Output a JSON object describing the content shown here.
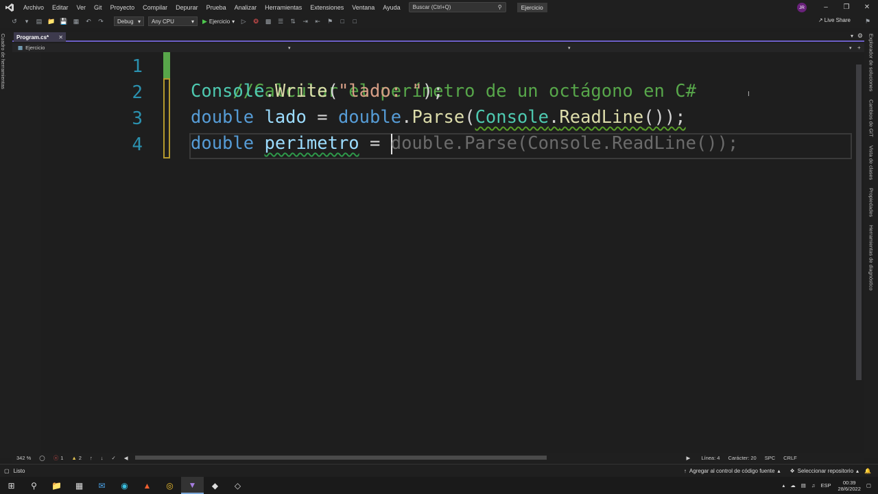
{
  "menu": {
    "items": [
      "Archivo",
      "Editar",
      "Ver",
      "Git",
      "Proyecto",
      "Compilar",
      "Depurar",
      "Prueba",
      "Analizar",
      "Herramientas",
      "Extensiones",
      "Ventana",
      "Ayuda"
    ],
    "search_placeholder": "Buscar (Ctrl+Q)",
    "solution_name": "Ejercicio",
    "user_initials": "JR"
  },
  "toolbar": {
    "config": "Debug",
    "platform": "Any CPU",
    "run_target": "Ejercicio",
    "live_share": "Live Share"
  },
  "left_rail": {
    "label": "Cuadro de herramientas"
  },
  "right_rail": {
    "labels": [
      "Explorador de soluciones",
      "Cambios de GIT",
      "Vista de clases",
      "Propiedades",
      "Herramientas de diagnóstico"
    ]
  },
  "editor": {
    "tab_label": "Program.cs*",
    "tab_close": "✕",
    "nav_project": "Ejercicio",
    "line_numbers": [
      "1",
      "2",
      "3",
      "4"
    ],
    "lines": {
      "l1": "//Calcular el perímetro de un octágono en C#",
      "l2_type": "Console",
      "l2_dot": ".",
      "l2_method": "Write",
      "l2_open": "(",
      "l2_str": "\"lado: \"",
      "l2_close": ");",
      "l3_kw": "double",
      "l3_var": " lado",
      "l3_eq": " = ",
      "l3_kw2": "double",
      "l3_dot": ".",
      "l3_method": "Parse",
      "l3_open": "(",
      "l3_type": "Console",
      "l3_dot2": ".",
      "l3_method2": "ReadLine",
      "l3_close": "());",
      "l4_kw": "double",
      "l4_space": " ",
      "l4_var": "perimetro",
      "l4_eq": " = ",
      "l4_ghost": "double.Parse(Console.ReadLine());"
    }
  },
  "editor_status": {
    "zoom": "342 %",
    "errors": "1",
    "warnings": "2",
    "line": "Línea: 4",
    "char": "Carácter: 20",
    "spc": "SPC",
    "crlf": "CRLF"
  },
  "statusbar": {
    "ready": "Listo",
    "add_source": "Agregar al control de código fuente",
    "select_repo": "Seleccionar repositorio"
  },
  "taskbar": {
    "lang": "ESP",
    "time": "00:39",
    "date": "28/6/2022"
  },
  "colors": {
    "accent": "#6c5fc7",
    "comment": "#57a64a",
    "keyword": "#569cd6",
    "type": "#4ec9b0"
  }
}
